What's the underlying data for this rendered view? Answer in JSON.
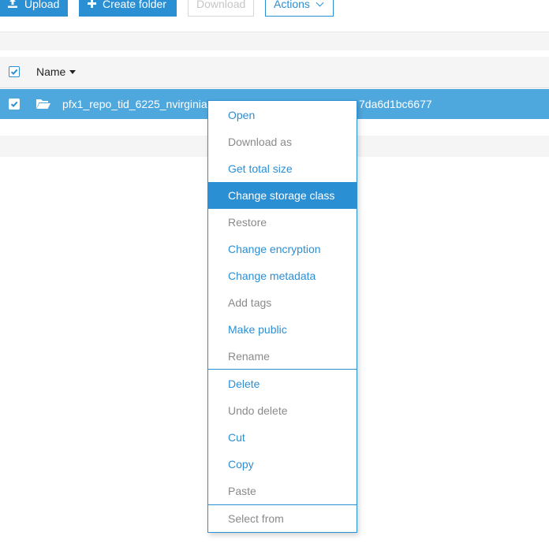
{
  "toolbar": {
    "upload_label": "Upload",
    "create_folder_label": "Create folder",
    "download_label": "Download",
    "actions_label": "Actions"
  },
  "list": {
    "name_header": "Name",
    "selected_item": {
      "name_visible_left": "pfx1_repo_tid_6225_nvirginia",
      "name_visible_right": "7da6d1bc6677"
    }
  },
  "context_menu": {
    "items": [
      {
        "label": "Open",
        "state": "enabled"
      },
      {
        "label": "Download as",
        "state": "disabled"
      },
      {
        "label": "Get total size",
        "state": "enabled"
      },
      {
        "label": "Change storage class",
        "state": "highlighted"
      },
      {
        "label": "Restore",
        "state": "disabled"
      },
      {
        "label": "Change encryption",
        "state": "enabled"
      },
      {
        "label": "Change metadata",
        "state": "enabled"
      },
      {
        "label": "Add tags",
        "state": "disabled"
      },
      {
        "label": "Make public",
        "state": "enabled"
      },
      {
        "label": "Rename",
        "state": "disabled"
      },
      {
        "label": "Delete",
        "state": "enabled"
      },
      {
        "label": "Undo delete",
        "state": "disabled"
      },
      {
        "label": "Cut",
        "state": "enabled"
      },
      {
        "label": "Copy",
        "state": "enabled"
      },
      {
        "label": "Paste",
        "state": "disabled"
      },
      {
        "label": "Select from",
        "state": "disabled"
      }
    ]
  },
  "colors": {
    "accent": "#2b8fd4",
    "selected_row": "#4ea8de",
    "disabled_text": "#8a8a8a"
  }
}
